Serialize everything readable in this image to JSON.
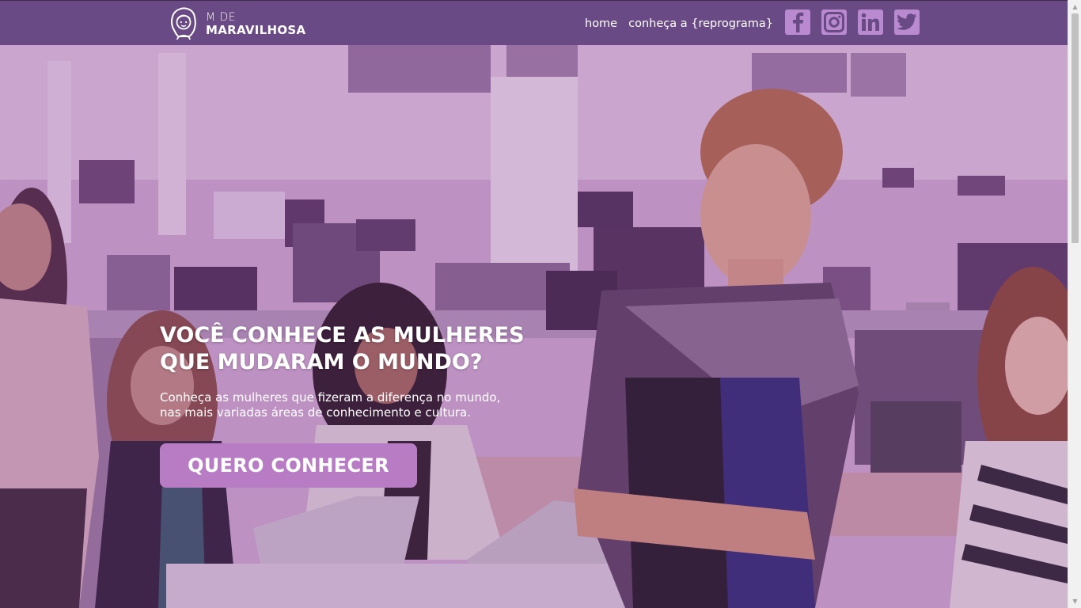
{
  "brand": {
    "line1": "M DE",
    "line2": "MARAVILHOSA",
    "logo_icon": "woman-face-icon"
  },
  "nav": {
    "items": [
      {
        "label": "home"
      },
      {
        "label": "conheça a {reprograma}"
      }
    ]
  },
  "social": [
    {
      "name": "facebook-icon"
    },
    {
      "name": "instagram-icon"
    },
    {
      "name": "linkedin-icon"
    },
    {
      "name": "twitter-icon"
    }
  ],
  "hero": {
    "title_line1": "VOCÊ CONHECE AS MULHERES",
    "title_line2": "QUE MUDARAM O MUNDO?",
    "subtitle_line1": "Conheça as mulheres que fizeram a diferença no mundo,",
    "subtitle_line2": "nas mais variadas áreas de conhecimento e cultura.",
    "cta_label": "QUERO CONHECER",
    "background_description": "photo-of-women-in-office"
  },
  "colors": {
    "header_bg": "#6a4a85",
    "social_icon_bg": "#b98ad0",
    "cta_bg": "#b87cc4",
    "hero_tint": "#cba5cf"
  }
}
